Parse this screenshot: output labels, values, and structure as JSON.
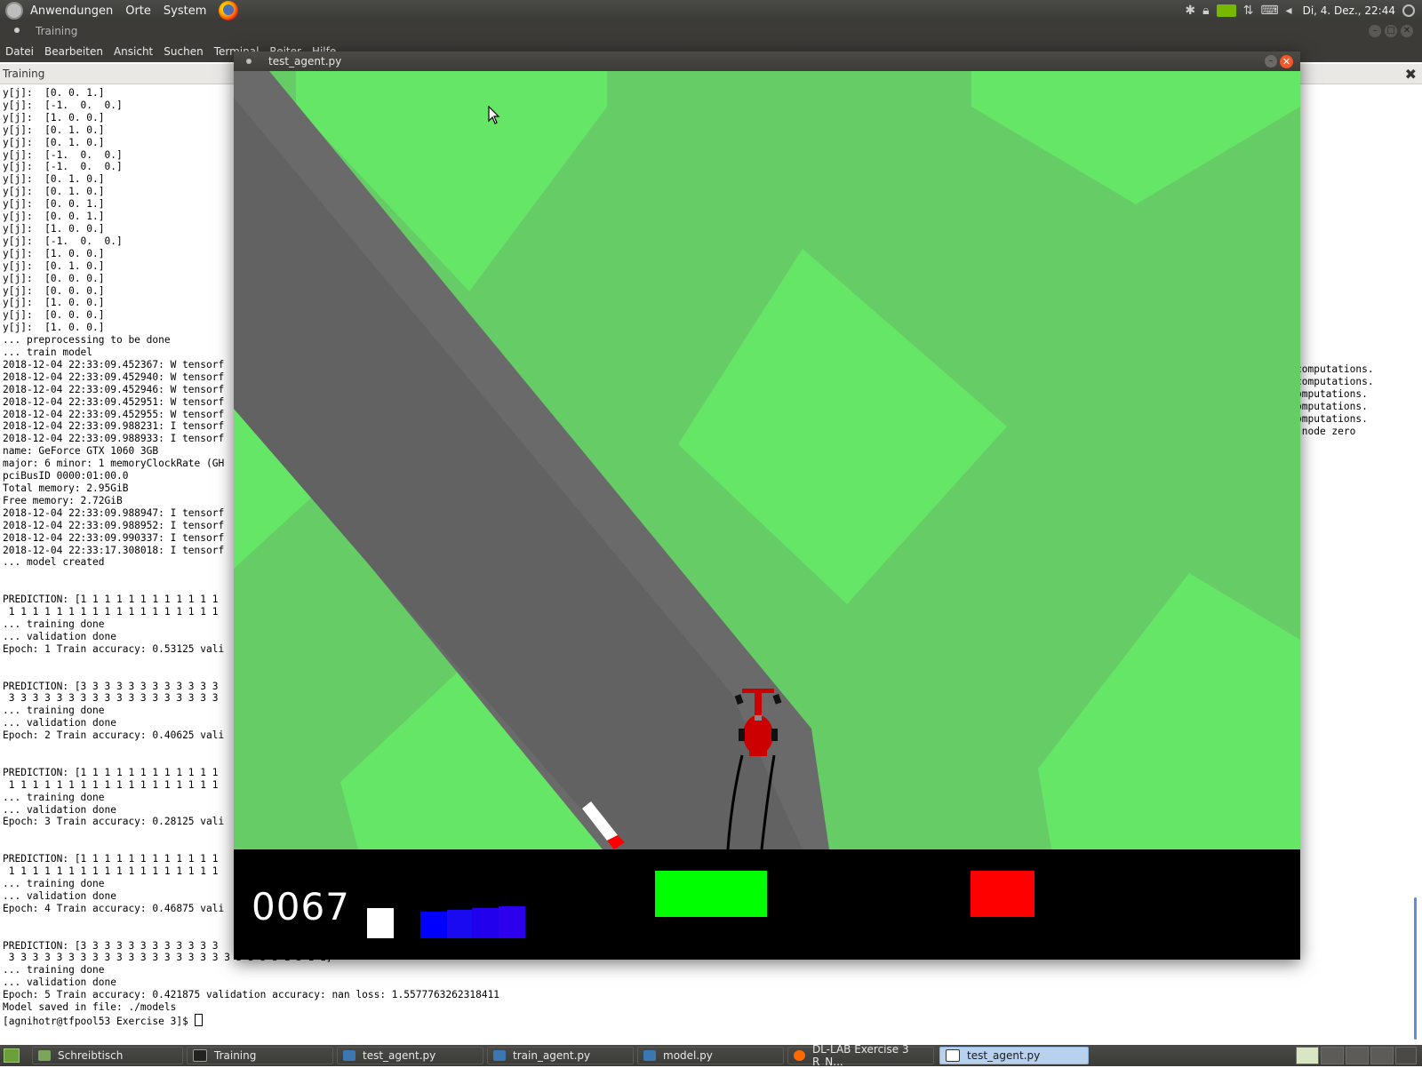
{
  "panel": {
    "menus": [
      "Anwendungen",
      "Orte",
      "System"
    ],
    "clock": "Di,  4. Dez., 22:44"
  },
  "terminal": {
    "window_title": "Training",
    "menu": [
      "Datei",
      "Bearbeiten",
      "Ansicht",
      "Suchen",
      "Terminal",
      "Reiter",
      "Hilfe"
    ],
    "tab_label": "Training",
    "lines": [
      "y[j]:  [0. 0. 1.]",
      "y[j]:  [-1.  0.  0.]",
      "y[j]:  [1. 0. 0.]",
      "y[j]:  [0. 1. 0.]",
      "y[j]:  [0. 1. 0.]",
      "y[j]:  [-1.  0.  0.]",
      "y[j]:  [-1.  0.  0.]",
      "y[j]:  [0. 1. 0.]",
      "y[j]:  [0. 1. 0.]",
      "y[j]:  [0. 0. 1.]",
      "y[j]:  [0. 0. 1.]",
      "y[j]:  [1. 0. 0.]",
      "y[j]:  [-1.  0.  0.]",
      "y[j]:  [1. 0. 0.]",
      "y[j]:  [0. 1. 0.]",
      "y[j]:  [0. 0. 0.]",
      "y[j]:  [0. 0. 0.]",
      "y[j]:  [1. 0. 0.]",
      "y[j]:  [0. 0. 0.]",
      "y[j]:  [1. 0. 0.]",
      "... preprocessing to be done",
      "... train model",
      "2018-12-04 22:33:09.452367: W tensorf",
      "2018-12-04 22:33:09.452940: W tensorf",
      "2018-12-04 22:33:09.452946: W tensorf",
      "2018-12-04 22:33:09.452951: W tensorf",
      "2018-12-04 22:33:09.452955: W tensorf",
      "2018-12-04 22:33:09.988231: I tensorf",
      "2018-12-04 22:33:09.988933: I tensorf",
      "name: GeForce GTX 1060 3GB",
      "major: 6 minor: 1 memoryClockRate (GH",
      "pciBusID 0000:01:00.0",
      "Total memory: 2.95GiB",
      "Free memory: 2.72GiB",
      "2018-12-04 22:33:09.988947: I tensorf",
      "2018-12-04 22:33:09.988952: I tensorf",
      "2018-12-04 22:33:09.990337: I tensorf",
      "2018-12-04 22:33:17.308018: I tensorf",
      "... model created",
      "",
      "",
      "PREDICTION: [1 1 1 1 1 1 1 1 1 1 1 1",
      " 1 1 1 1 1 1 1 1 1 1 1 1 1 1 1 1 1 1",
      "... training done",
      "... validation done",
      "Epoch: 1 Train accuracy: 0.53125 vali",
      "",
      "",
      "PREDICTION: [3 3 3 3 3 3 3 3 3 3 3 3",
      " 3 3 3 3 3 3 3 3 3 3 3 3 3 3 3 3 3 3",
      "... training done",
      "... validation done",
      "Epoch: 2 Train accuracy: 0.40625 vali",
      "",
      "",
      "PREDICTION: [1 1 1 1 1 1 1 1 1 1 1 1",
      " 1 1 1 1 1 1 1 1 1 1 1 1 1 1 1 1 1 1",
      "... training done",
      "... validation done",
      "Epoch: 3 Train accuracy: 0.28125 vali",
      "",
      "",
      "PREDICTION: [1 1 1 1 1 1 1 1 1 1 1 1",
      " 1 1 1 1 1 1 1 1 1 1 1 1 1 1 1 1 1 1",
      "... training done",
      "... validation done",
      "Epoch: 4 Train accuracy: 0.46875 vali",
      "",
      "",
      "PREDICTION: [3 3 3 3 3 3 3 3 3 3 3 3",
      " 3 3 3 3 3 3 3 3 3 3 3 3 3 3 3 3 3 3 3 3 3 3 3 1 3 1 1]",
      "... training done",
      "... validation done",
      "Epoch: 5 Train accuracy: 0.421875 validation accuracy: nan loss: 1.5577763262318411",
      "Model saved in file: ./models"
    ],
    "prompt": "[agnihotr@tfpool53 Exercise 3]$ ",
    "right_fragments": [
      "computations.",
      "computations.",
      "omputations.",
      "omputations.",
      "omputations.",
      " node zero"
    ]
  },
  "game": {
    "window_title": "test_agent.py",
    "score": "0067",
    "colors": {
      "grass_dark": "#66cc66",
      "grass_light": "#66e666",
      "road": "#666666",
      "car": "#cc0000"
    }
  },
  "taskbar": {
    "tasks": [
      {
        "label": "Schreibtisch",
        "icon": "files-icon"
      },
      {
        "label": "Training",
        "icon": "terminal-icon"
      },
      {
        "label": "test_agent.py",
        "icon": "python-icon"
      },
      {
        "label": "train_agent.py",
        "icon": "python-icon"
      },
      {
        "label": "model.py",
        "icon": "python-icon"
      },
      {
        "label": "DL-LAB Exercise 3 R_N...",
        "icon": "firefox-icon"
      },
      {
        "label": "test_agent.py",
        "icon": "window-icon"
      }
    ]
  }
}
